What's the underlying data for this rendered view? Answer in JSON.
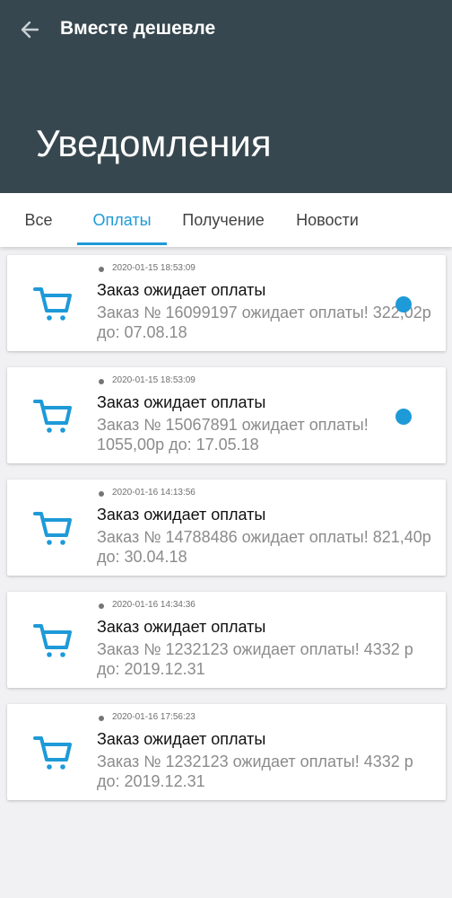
{
  "header": {
    "title": "Вместе дешевле",
    "page_title": "Уведомления"
  },
  "tabs": [
    {
      "label": "Все",
      "active": false
    },
    {
      "label": "Оплаты",
      "active": true
    },
    {
      "label": "Получение",
      "active": false
    },
    {
      "label": "Новости",
      "active": false
    }
  ],
  "notifications": [
    {
      "timestamp": "2020-01-15 18:53:09",
      "title": "Заказ ожидает оплаты",
      "body": "Заказ № 16099197 ожидает оплаты! 322,02р до: 07.08.18",
      "unread": true
    },
    {
      "timestamp": "2020-01-15 18:53:09",
      "title": "Заказ ожидает оплаты",
      "body": "Заказ № 15067891 ожидает оплаты! 1055,00р до: 17.05.18",
      "unread": true
    },
    {
      "timestamp": "2020-01-16 14:13:56",
      "title": "Заказ ожидает оплаты",
      "body": "Заказ № 14788486 ожидает оплаты! 821,40р до: 30.04.18",
      "unread": false
    },
    {
      "timestamp": "2020-01-16 14:34:36",
      "title": "Заказ ожидает оплаты",
      "body": "Заказ № 1232123 ожидает оплаты! 4332 р до: 2019.12.31",
      "unread": false
    },
    {
      "timestamp": "2020-01-16 17:56:23",
      "title": "Заказ ожидает оплаты",
      "body": "Заказ № 1232123 ожидает оплаты! 4332 р до: 2019.12.31",
      "unread": false
    }
  ],
  "icons": {
    "back": "arrow-left-icon",
    "notification": "shopping-cart-icon",
    "unread": "unread-dot-icon"
  },
  "colors": {
    "appbar": "#37474f",
    "accent": "#1e9ad8",
    "background": "#f1f1f3"
  }
}
